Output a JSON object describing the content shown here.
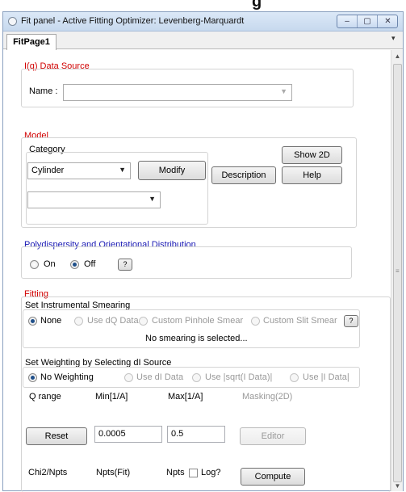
{
  "window": {
    "title": "Fit panel - Active Fitting Optimizer: Levenberg-Marquardt",
    "controls": {
      "minimize": "–",
      "maximize": "▢",
      "close": "✕"
    }
  },
  "top_fragment": "g",
  "tabs": [
    {
      "label": "FitPage1",
      "selected": true
    }
  ],
  "tab_menu_glyph": "▾",
  "data_source": {
    "title": "I(q) Data Source",
    "name_label": "Name :",
    "name_value": ""
  },
  "model": {
    "title": "Model",
    "category_label": "Category",
    "category_value": "Cylinder",
    "model_value": "",
    "buttons": {
      "modify": "Modify",
      "description": "Description",
      "show2d": "Show 2D",
      "help": "Help"
    }
  },
  "polydispersity": {
    "title": "Polydispersity and Orientational Distribution",
    "on_label": "On",
    "off_label": "Off",
    "selected": "Off",
    "help_label": "?"
  },
  "fitting": {
    "title": "Fitting",
    "smearing": {
      "label": "Set Instrumental Smearing",
      "options": [
        "None",
        "Use dQ Data",
        "Custom Pinhole Smear",
        "Custom Slit Smear"
      ],
      "selected": "None",
      "help_label": "?",
      "status": "No smearing is selected..."
    },
    "weighting": {
      "label": "Set Weighting by Selecting dI Source",
      "options": [
        "No Weighting",
        "Use dI Data",
        "Use |sqrt(I Data)|",
        "Use |I Data|"
      ],
      "selected": "No Weighting"
    },
    "qrange": {
      "label": "Q range",
      "min_label": "Min[1/A]",
      "max_label": "Max[1/A]",
      "masking_label": "Masking(2D)",
      "min_value": "0.0005",
      "max_value": "0.5",
      "reset_label": "Reset",
      "editor_label": "Editor"
    },
    "results": {
      "chi2_label": "Chi2/Npts",
      "nptsfit_label": "Npts(Fit)",
      "npts_label": "Npts",
      "log_label": "Log?",
      "compute_label": "Compute"
    }
  },
  "scrollbar": {
    "up": "▲",
    "down": "▼",
    "grip": "≡"
  }
}
